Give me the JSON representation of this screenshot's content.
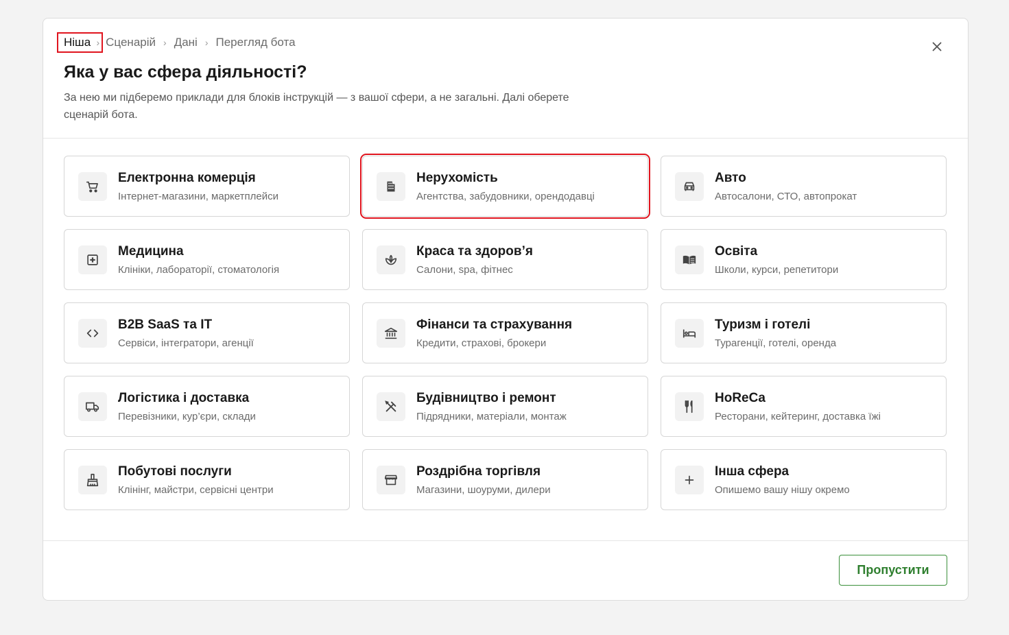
{
  "breadcrumb": {
    "items": [
      "Ніша",
      "Сценарій",
      "Дані",
      "Перегляд бота"
    ]
  },
  "header": {
    "title": "Яка у вас сфера діяльності?",
    "subtitle": "За нею ми підберемо приклади для блоків інструкцій — з вашої сфери, а не загальні. Далі оберете сценарій бота."
  },
  "cards": [
    {
      "title": "Електронна комерція",
      "desc": "Інтернет-магазини, маркетплейси",
      "icon": "cart-icon"
    },
    {
      "title": "Нерухомість",
      "desc": "Агентства, забудовники, орендодавці",
      "icon": "building-icon"
    },
    {
      "title": "Авто",
      "desc": "Автосалони, СТО, автопрокат",
      "icon": "car-icon"
    },
    {
      "title": "Медицина",
      "desc": "Клініки, лабораторії, стоматологія",
      "icon": "medical-icon"
    },
    {
      "title": "Краса та здоров’я",
      "desc": "Салони, spa, фітнес",
      "icon": "spa-icon"
    },
    {
      "title": "Освіта",
      "desc": "Школи, курси, репетитори",
      "icon": "book-icon"
    },
    {
      "title": "B2B SaaS та IT",
      "desc": "Сервіси, інтегратори, агенції",
      "icon": "code-icon"
    },
    {
      "title": "Фінанси та страхування",
      "desc": "Кредити, страхові, брокери",
      "icon": "bank-icon"
    },
    {
      "title": "Туризм і готелі",
      "desc": "Турагенції, готелі, оренда",
      "icon": "bed-icon"
    },
    {
      "title": "Логістика і доставка",
      "desc": "Перевізники, кур’єри, склади",
      "icon": "truck-icon"
    },
    {
      "title": "Будівництво і ремонт",
      "desc": "Підрядники, матеріали, монтаж",
      "icon": "tools-icon"
    },
    {
      "title": "HoReCa",
      "desc": "Ресторани, кейтеринг, доставка їжі",
      "icon": "restaurant-icon"
    },
    {
      "title": "Побутові послуги",
      "desc": "Клінінг, майстри, сервісні центри",
      "icon": "cleaning-icon"
    },
    {
      "title": "Роздрібна торгівля",
      "desc": "Магазини, шоуруми, дилери",
      "icon": "store-icon"
    },
    {
      "title": "Інша сфера",
      "desc": "Опишемо вашу нішу окремо",
      "icon": "plus-icon"
    }
  ],
  "footer": {
    "skip_label": "Пропустити"
  },
  "colors": {
    "highlight": "#e0141e",
    "accent_green": "#2f7f2f"
  }
}
